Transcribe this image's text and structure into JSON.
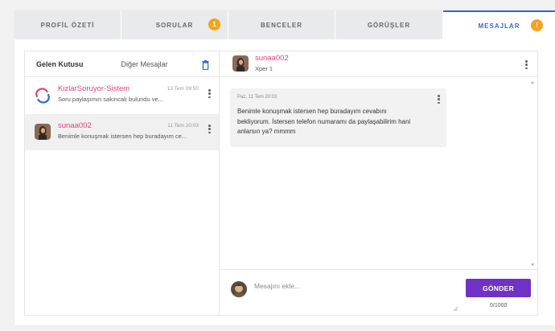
{
  "tabs": [
    {
      "label": "PROFİL ÖZETİ",
      "badge": "",
      "active": false
    },
    {
      "label": "SORULAR",
      "badge": "1",
      "active": false
    },
    {
      "label": "BENCELER",
      "badge": "",
      "active": false
    },
    {
      "label": "GÖRÜŞLER",
      "badge": "",
      "active": false
    },
    {
      "label": "MESAJLAR",
      "badge": "!",
      "active": true
    }
  ],
  "inbox": {
    "tab_inbox": "Gelen Kutusu",
    "tab_other": "Diğer Mesajlar",
    "conversations": [
      {
        "name": "KizlarSoruyor-Sistem",
        "time": "13 Tem 09:50",
        "preview": "Soru paylaşımın sakıncalı bulundu ve...",
        "selected": false
      },
      {
        "name": "sunaa002",
        "time": "11 Tem 20:03",
        "preview": "Benimle konuşmak istersen hep buradayım ce...",
        "selected": true
      }
    ]
  },
  "chat": {
    "name": "sunaa002",
    "subtitle": "Xper 1",
    "messages": [
      {
        "date": "Paz, 11 Tem 20:03",
        "text": "Benimle konuşmak istersen hep buradayım cevabını bekliyorum. İstersen telefon numaramı da paylaşabilirim hani anlarsın ya? mmmm"
      }
    ],
    "input_placeholder": "Mesajını ekle...",
    "input_value": "",
    "send_label": "GÖNDER",
    "char_count": "0/1000"
  },
  "colors": {
    "accent_blue": "#2c6bd1",
    "badge_orange": "#f6a31b",
    "username_pink": "#e83e79",
    "send_purple": "#6f32c4"
  },
  "icons": [
    "trash-icon",
    "more-vertical-icon",
    "avatar",
    "system-logo-icon",
    "resize-grip-icon"
  ]
}
